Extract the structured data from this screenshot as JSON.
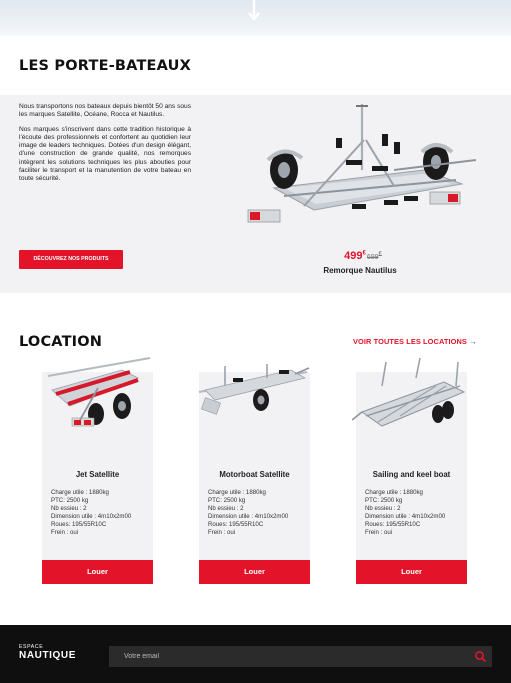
{
  "porte": {
    "title": "LES PORTE-BATEAUX",
    "para1": "Nous transportons nos bateaux depuis bientôt 50 ans sous les marques Satellite, Océane, Rocca et Nautilus.",
    "para2": "Nos marques s'inscrivent dans cette tradition historique à l'écoute des professionnels et confortent au quotidien leur image de leaders techniques. Dotées d'un design élégant, d'une construction de grande qualité, nos remorques intègrent les solutions techniques les plus abouties pour faciliter le transport et la manutention de votre bateau en toute sécurité.",
    "button": "DÉCOUVREZ NOS PRODUITS",
    "product": {
      "price_new": "499",
      "price_new_sup": "€",
      "price_old": "699",
      "price_old_sup": "€",
      "name": "Remorque Nautilus"
    }
  },
  "location": {
    "title": "LOCATION",
    "see_all": "VOIR TOUTES LES LOCATIONS",
    "see_all_arrow": "→",
    "cards": [
      {
        "title": "Jet Satellite",
        "specs": [
          "Charge utile : 1880kg",
          "PTC: 2500 kg",
          "Nb essieu : 2",
          "Dimension utile : 4m10x2m00",
          "Roues: 195/55R10C",
          "Frein : oui"
        ],
        "button": "Louer"
      },
      {
        "title": "Motorboat Satellite",
        "specs": [
          "Charge utile : 1880kg",
          "PTC: 2500 kg",
          "Nb essieu : 2",
          "Dimension utile : 4m10x2m00",
          "Roues: 195/55R10C",
          "Frein : oui"
        ],
        "button": "Louer"
      },
      {
        "title": "Sailing and keel boat",
        "specs": [
          "Charge utile : 1880kg",
          "PTC: 2500 kg",
          "Nb essieu : 2",
          "Dimension utile : 4m10x2m00",
          "Roues: 195/55R10C",
          "Frein : oui"
        ],
        "button": "Louer"
      }
    ]
  },
  "footer": {
    "logo_top": "ESPACE",
    "logo_main": "NAUTIQUE",
    "email_placeholder": "Votre email"
  },
  "icons": {
    "hero_arrow": "arrow-down-icon",
    "search": "search-icon"
  },
  "colors": {
    "accent": "#e3132a",
    "panel": "#f2f2f5",
    "footer": "#0f0f0f"
  }
}
